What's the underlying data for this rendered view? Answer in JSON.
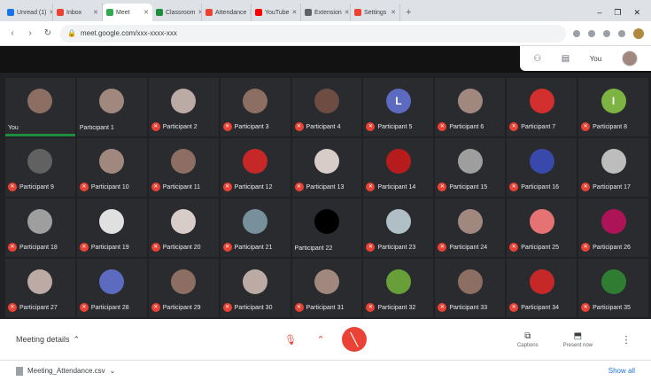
{
  "browser": {
    "tabs": [
      {
        "label": "Unread (1)",
        "color": "#1a73e8",
        "active": false
      },
      {
        "label": "Inbox",
        "color": "#ea4335",
        "active": false
      },
      {
        "label": "Meet",
        "color": "#34a853",
        "active": true
      },
      {
        "label": "Classroom",
        "color": "#1e8e3e",
        "active": false
      },
      {
        "label": "Attendance",
        "color": "#ea4335",
        "active": false
      },
      {
        "label": "YouTube",
        "color": "#ff0000",
        "active": false
      },
      {
        "label": "Extension",
        "color": "#5f6368",
        "active": false
      },
      {
        "label": "Settings",
        "color": "#ea4335",
        "active": false
      }
    ],
    "url": "meet.google.com/xxx-xxxx-xxx",
    "new_tab": "+",
    "window_controls": [
      "–",
      "❐",
      "✕"
    ]
  },
  "meet": {
    "top_right": {
      "chat_icon": "chat-icon",
      "people_icon": "people-icon",
      "you_label": "You"
    },
    "participants": [
      {
        "name": "You",
        "avatar": "#8d6e63",
        "initial": "",
        "active": true,
        "muted": false
      },
      {
        "name": "Participant 1",
        "avatar": "#a1887f",
        "initial": "",
        "muted": false
      },
      {
        "name": "Participant 2",
        "avatar": "#bcaaa4",
        "initial": "",
        "muted": true
      },
      {
        "name": "Participant 3",
        "avatar": "#8d6e63",
        "initial": "",
        "muted": true
      },
      {
        "name": "Participant 4",
        "avatar": "#6d4c41",
        "initial": "",
        "muted": true
      },
      {
        "name": "Participant 5",
        "avatar": "#5c6bc0",
        "initial": "L",
        "muted": true
      },
      {
        "name": "Participant 6",
        "avatar": "#a1887f",
        "initial": "",
        "muted": true
      },
      {
        "name": "Participant 7",
        "avatar": "#d32f2f",
        "initial": "",
        "muted": true
      },
      {
        "name": "Participant 8",
        "avatar": "#7cb342",
        "initial": "I",
        "muted": true
      },
      {
        "name": "Participant 9",
        "avatar": "#616161",
        "initial": "",
        "muted": true
      },
      {
        "name": "Participant 10",
        "avatar": "#a1887f",
        "initial": "",
        "muted": true
      },
      {
        "name": "Participant 11",
        "avatar": "#8d6e63",
        "initial": "",
        "muted": true
      },
      {
        "name": "Participant 12",
        "avatar": "#c62828",
        "initial": "",
        "muted": true
      },
      {
        "name": "Participant 13",
        "avatar": "#d7ccc8",
        "initial": "",
        "muted": true
      },
      {
        "name": "Participant 14",
        "avatar": "#b71c1c",
        "initial": "",
        "muted": true
      },
      {
        "name": "Participant 15",
        "avatar": "#9e9e9e",
        "initial": "",
        "muted": true
      },
      {
        "name": "Participant 16",
        "avatar": "#3949ab",
        "initial": "",
        "muted": true
      },
      {
        "name": "Participant 17",
        "avatar": "#bdbdbd",
        "initial": "",
        "muted": true
      },
      {
        "name": "Participant 18",
        "avatar": "#9e9e9e",
        "initial": "",
        "muted": true
      },
      {
        "name": "Participant 19",
        "avatar": "#e0e0e0",
        "initial": "",
        "muted": true
      },
      {
        "name": "Participant 20",
        "avatar": "#d7ccc8",
        "initial": "",
        "muted": true
      },
      {
        "name": "Participant 21",
        "avatar": "#78909c",
        "initial": "",
        "muted": true
      },
      {
        "name": "Participant 22",
        "avatar": "#000000",
        "initial": "",
        "muted": false
      },
      {
        "name": "Participant 23",
        "avatar": "#b0bec5",
        "initial": "",
        "muted": true
      },
      {
        "name": "Participant 24",
        "avatar": "#a1887f",
        "initial": "",
        "muted": true
      },
      {
        "name": "Participant 25",
        "avatar": "#e57373",
        "initial": "",
        "muted": true
      },
      {
        "name": "Participant 26",
        "avatar": "#ad1457",
        "initial": "",
        "muted": true
      },
      {
        "name": "Participant 27",
        "avatar": "#bcaaa4",
        "initial": "",
        "muted": true
      },
      {
        "name": "Participant 28",
        "avatar": "#5c6bc0",
        "initial": "",
        "muted": true
      },
      {
        "name": "Participant 29",
        "avatar": "#8d6e63",
        "initial": "",
        "muted": true
      },
      {
        "name": "Participant 30",
        "avatar": "#bcaaa4",
        "initial": "",
        "muted": true
      },
      {
        "name": "Participant 31",
        "avatar": "#a1887f",
        "initial": "",
        "muted": true
      },
      {
        "name": "Participant 32",
        "avatar": "#689f38",
        "initial": "",
        "muted": true
      },
      {
        "name": "Participant 33",
        "avatar": "#8d6e63",
        "initial": "",
        "muted": true
      },
      {
        "name": "Participant 34",
        "avatar": "#c62828",
        "initial": "",
        "muted": true
      },
      {
        "name": "Participant 35",
        "avatar": "#2e7d32",
        "initial": "",
        "muted": true
      }
    ],
    "controls": {
      "meeting_details_label": "Meeting details",
      "mic_icon": "mic-icon",
      "camera_icon": "camera-icon",
      "hangup_icon": "hangup-icon",
      "present_label": "Present now",
      "captions_label": "Captions"
    }
  },
  "downloads": {
    "file": "Meeting_Attendance.csv",
    "show_all": "Show all"
  }
}
